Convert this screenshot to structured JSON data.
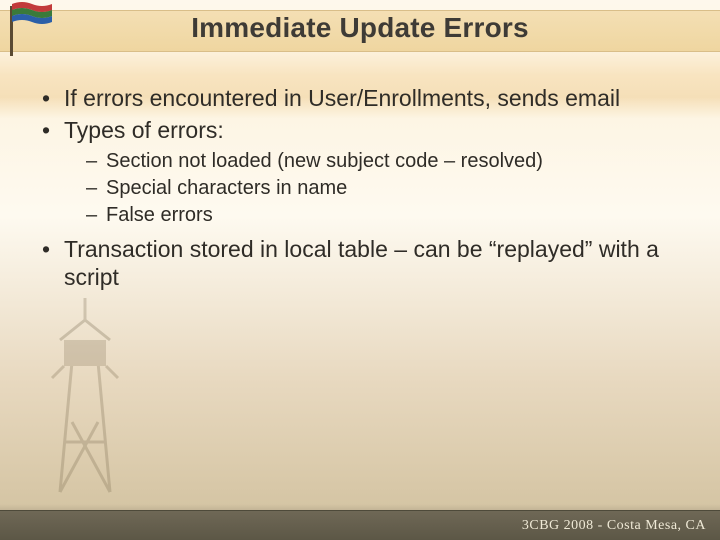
{
  "header": {
    "title": "Immediate Update Errors"
  },
  "bullets": [
    {
      "text": "If errors encountered in User/Enrollments, sends email"
    },
    {
      "text": "Types of errors:",
      "sub": [
        "Section not loaded (new subject code – resolved)",
        "Special characters in name",
        "False errors"
      ]
    },
    {
      "text": "Transaction stored in local table – can be “replayed” with a script"
    }
  ],
  "footer": {
    "text": "3CBG 2008 - Costa Mesa, CA"
  }
}
